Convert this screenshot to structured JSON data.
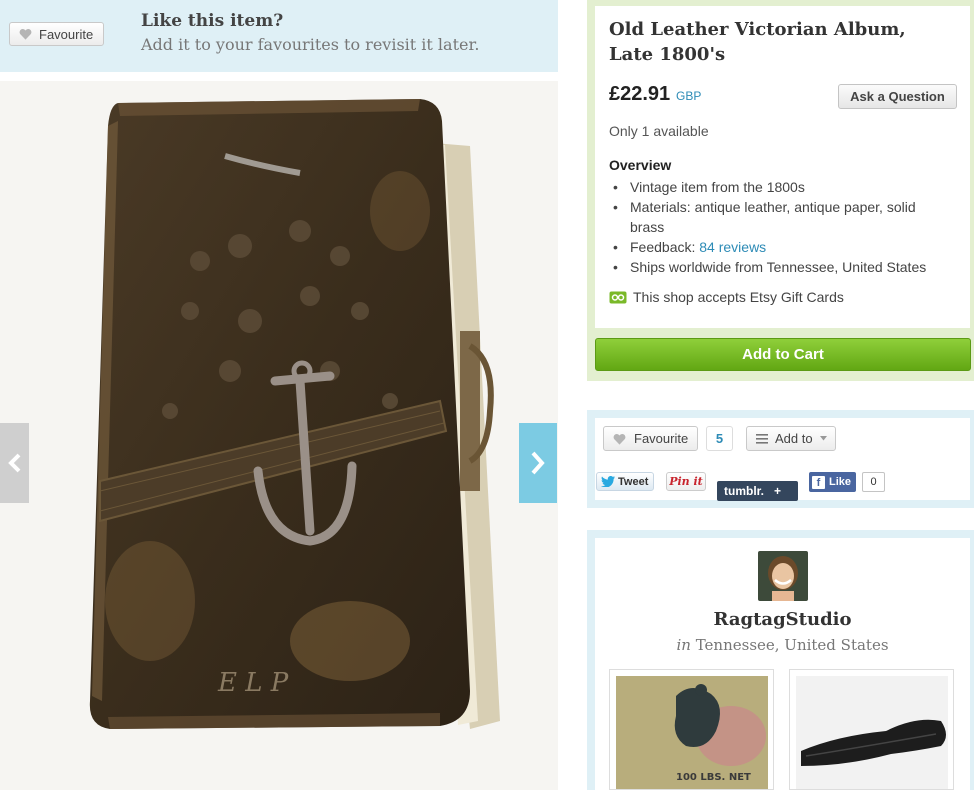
{
  "favourite_banner": {
    "button_label": "Favourite",
    "title": "Like this item?",
    "subtitle": "Add it to your favourites to revisit it later."
  },
  "listing": {
    "title": "Old Leather Victorian Album, Late 1800's",
    "price": "£22.91",
    "currency": "GBP",
    "ask_button": "Ask a Question",
    "availability": "Only 1 available",
    "overview_heading": "Overview",
    "overview": {
      "item1": "Vintage item from the 1800s",
      "item2": "Materials: antique leather, antique paper, solid brass",
      "feedback_prefix": "Feedback: ",
      "feedback_link": "84 reviews",
      "item4": "Ships worldwide from Tennessee, United States"
    },
    "gift_cards": "This shop accepts Etsy Gift Cards",
    "add_to_cart": "Add to Cart"
  },
  "social": {
    "favourite_label": "Favourite",
    "favourite_count": "5",
    "add_to_label": "Add to",
    "tweet_label": "Tweet",
    "pinit_label": "Pin it",
    "tumblr_label": "tumblr.",
    "tumblr_plus": "+",
    "like_label": "Like",
    "like_count": "0"
  },
  "shop": {
    "name": "RagtagStudio",
    "location_prefix": "in",
    "location": "Tennessee, United States",
    "thumb_text": "100 LBS. NET"
  },
  "photo": {
    "monogram": "E L P"
  },
  "colors": {
    "banner_blue": "#dff0f6",
    "info_green": "#e3efd0",
    "cart_green": "#7ab929",
    "link_blue": "#2d8bb6"
  }
}
